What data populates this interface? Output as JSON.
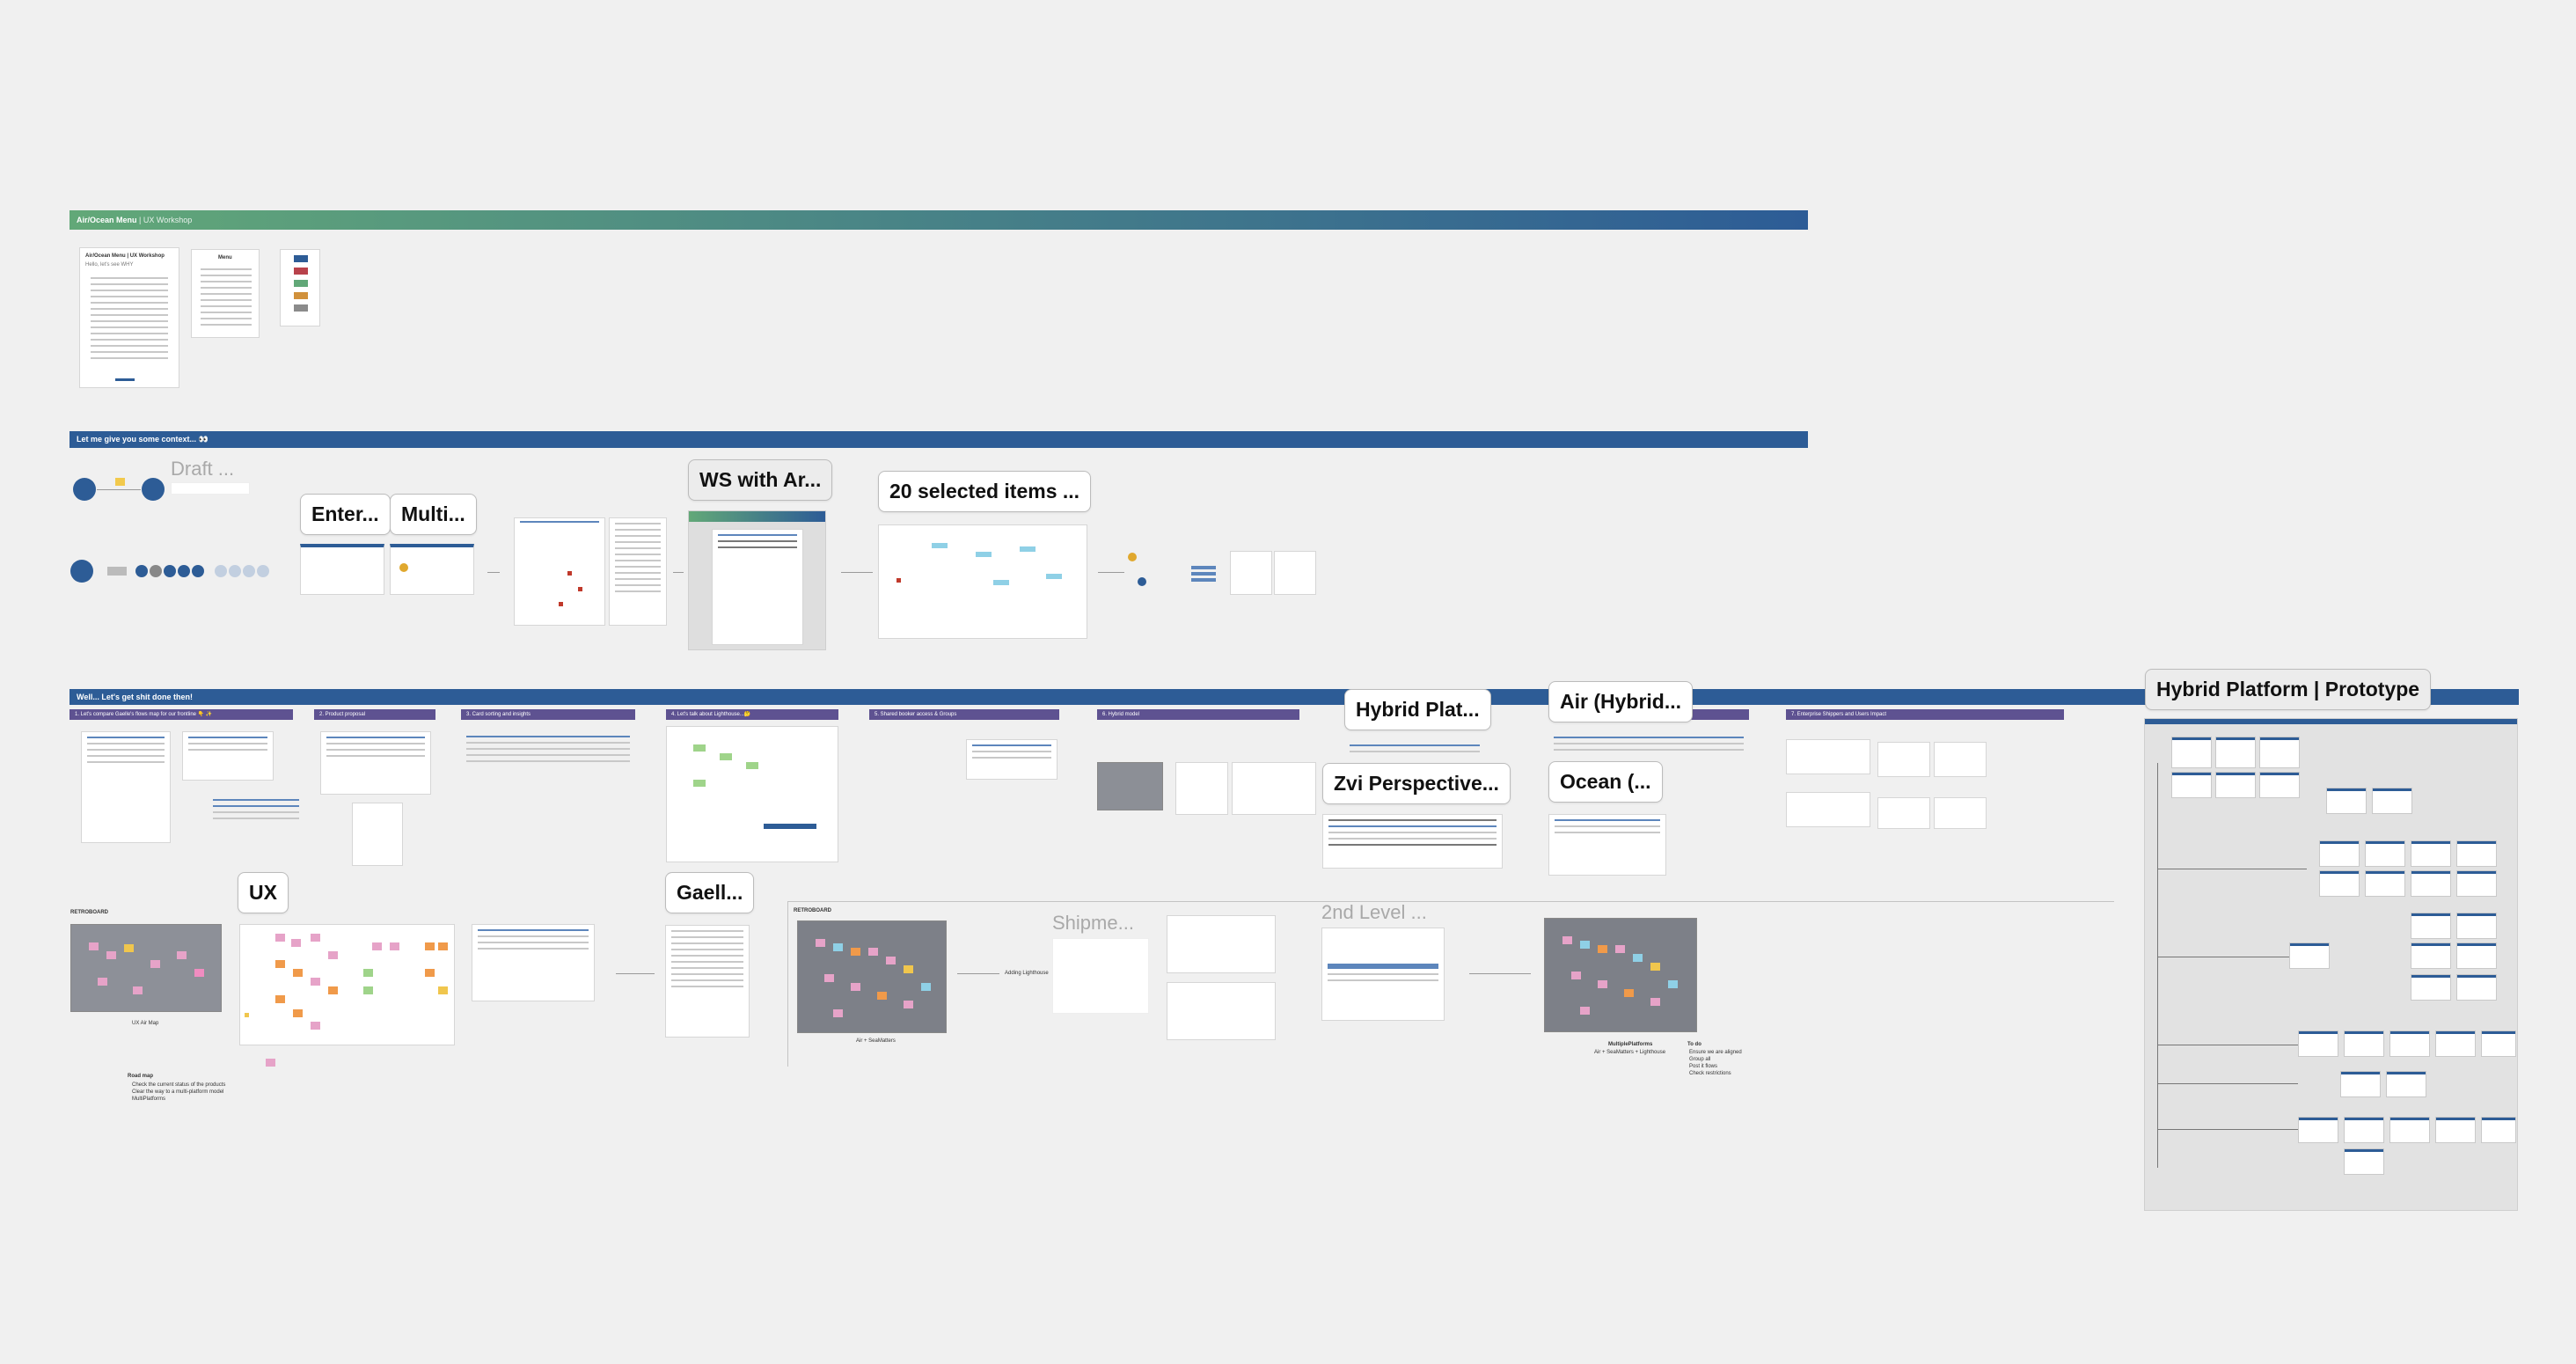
{
  "board": {
    "background": "#f0f0f0",
    "accent": "#2d5c96",
    "purple": "#5e5291"
  },
  "header_band": {
    "title": "Air/Ocean Menu",
    "subtitle": "| UX Workshop",
    "gradient_from": "#62a878",
    "gradient_to": "#2d5c96"
  },
  "section1": {
    "title": "Let me give you some context... 👀"
  },
  "section2": {
    "title": "Well... Let's get shit done then!"
  },
  "intro_doc": {
    "title": "Air/Ocean Menu | UX Workshop",
    "greeting": "Hello, let's see WHY"
  },
  "menu_doc": {
    "title": "Menu"
  },
  "labels": {
    "draft": "Draft ...",
    "enter": "Enter...",
    "multi": "Multi...",
    "ws_with_ar": "WS with Ar...",
    "selected_items": "20 selected items ...",
    "hybrid_plat": "Hybrid Plat...",
    "air_hybrid": "Air (Hybrid...",
    "zvi_perspective": "Zvi Perspective...",
    "ocean": "Ocean (...",
    "ux": "UX",
    "gaell": "Gaell...",
    "shipme": "Shipme...",
    "second_level": "2nd Level ...",
    "hybrid_prototype": "Hybrid Platform | Prototype"
  },
  "purple_tabs": [
    "1. Let's compare Gaelle's flows map for our frontline 👇 ✨",
    "2. Product proposal",
    "3. Card sorting and insights",
    "4. Let's talk about Lighthouse...🤔",
    "5. Shared booker access & Groups",
    "6. Hybrid model",
    "",
    "",
    "7. Enterprise Shippers and Users Impact"
  ],
  "captions": {
    "workshop_left": "RETROBOARD",
    "workshop_mid": "RETROBOARD",
    "wall1": "UX Air Map",
    "wall2": "Air + SeaMatters",
    "wall3": "MultiplePlatforms",
    "wall3_sub": "Air + SeaMatters + Lighthouse",
    "adding_lighthouse": "Adding Lighthouse",
    "road_map": "Road map",
    "todo": "To do"
  },
  "todo_items": [
    "Ensure we are aligned",
    "Group all",
    "Post it flows",
    "Check restrictions"
  ],
  "road_map_items": [
    "Check the current status of the products",
    "Clear the way to a multi-platform model",
    "MultiPlatforms"
  ]
}
